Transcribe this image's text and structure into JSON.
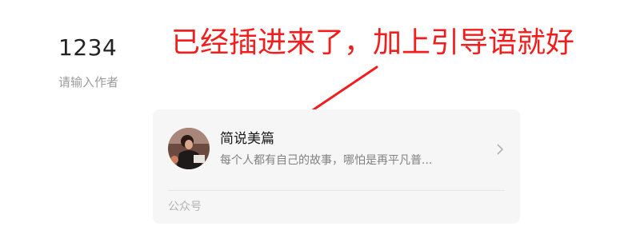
{
  "article": {
    "title": "1234",
    "author_placeholder": "请输入作者"
  },
  "annotation": {
    "text": "已经插进来了，加上引导语就好",
    "color": "#f21d1d"
  },
  "account_card": {
    "name": "简说美篇",
    "description": "每个人都有自己的故事，哪怕是再平凡普...",
    "footer_label": "公众号",
    "avatar_icon": "profile-photo-avatar",
    "chevron_icon": "chevron-right-icon"
  }
}
